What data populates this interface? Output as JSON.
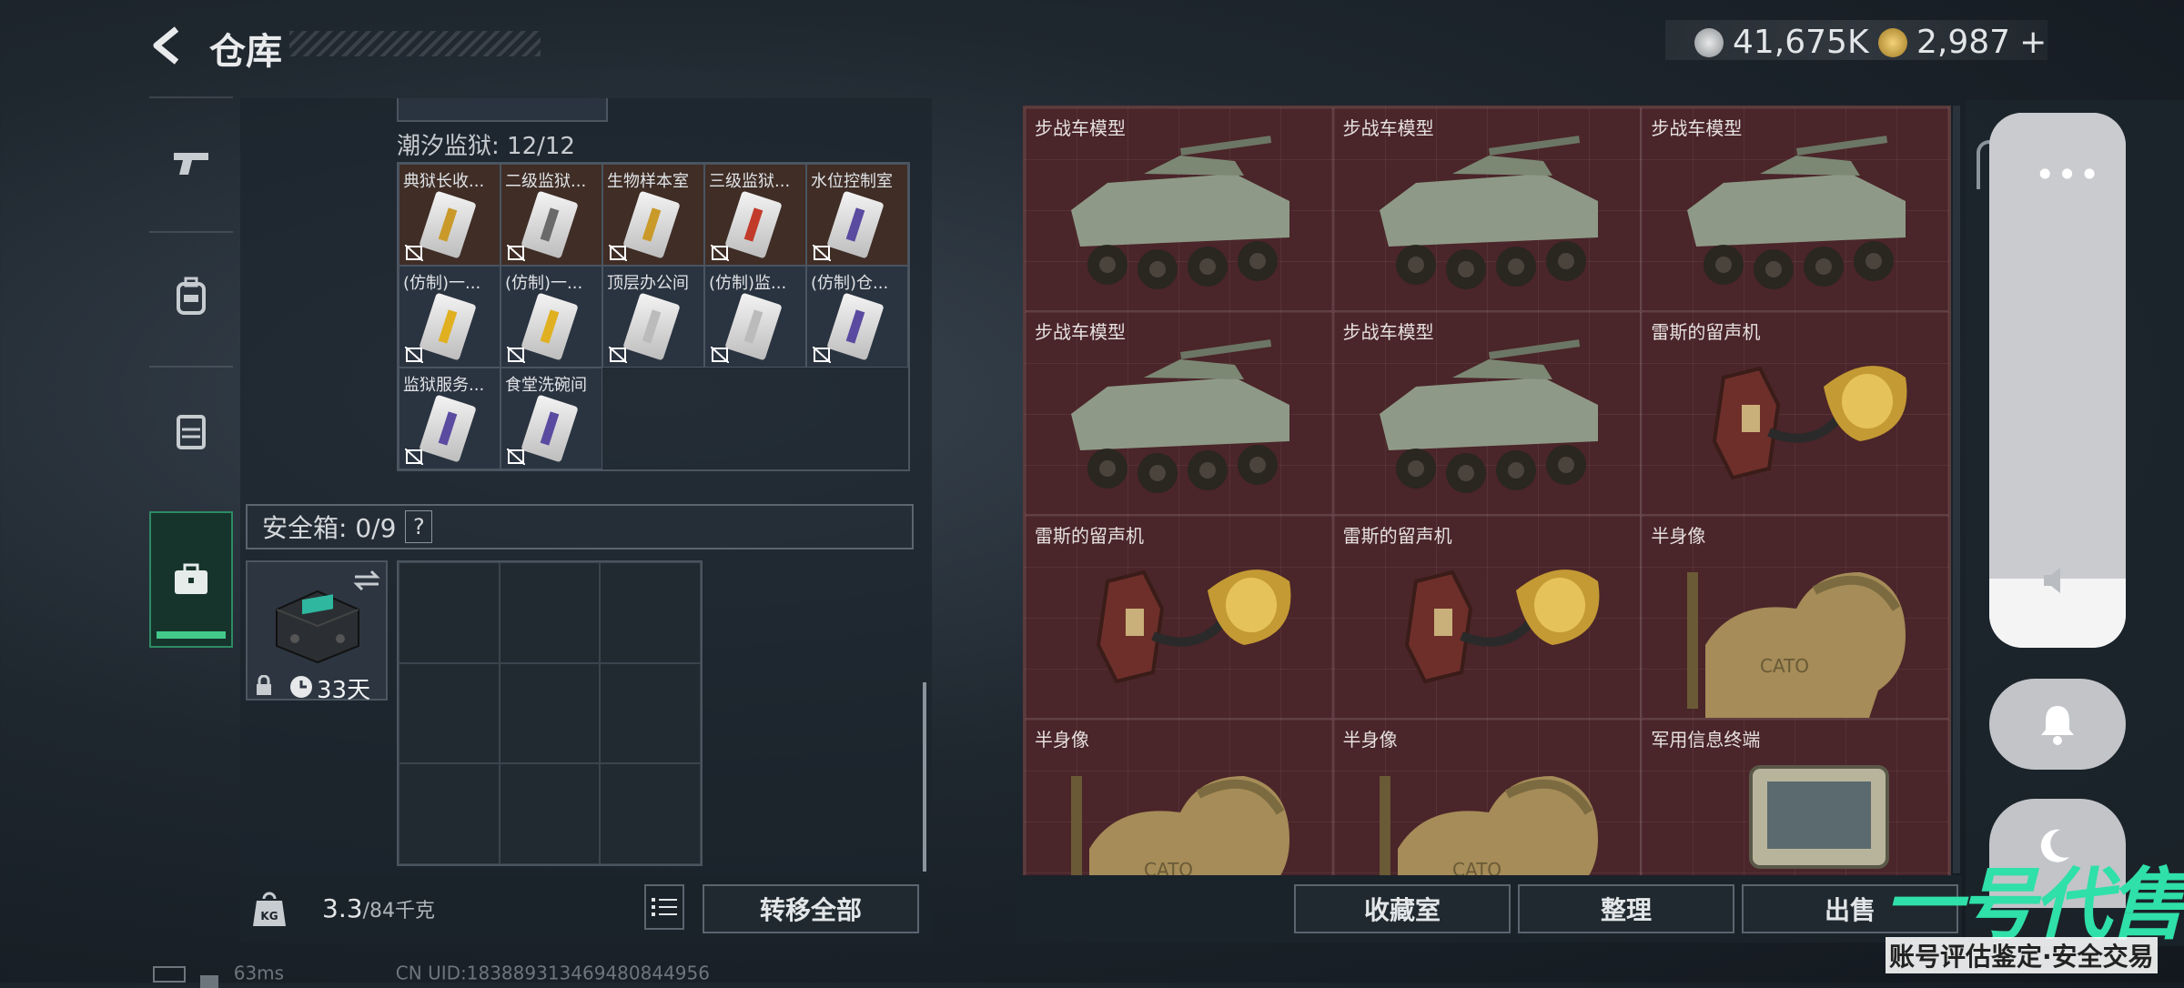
{
  "header": {
    "title": "仓库",
    "currency_1": "41,675K",
    "currency_2": "2,987",
    "currency_2_suffix": "+"
  },
  "left_tabs": [
    {
      "icon": "gun-icon"
    },
    {
      "icon": "backpack-icon"
    },
    {
      "icon": "vest-icon"
    },
    {
      "icon": "briefcase-icon",
      "active": true
    }
  ],
  "key_section": {
    "label": "潮汐监狱: 12/12",
    "items": [
      {
        "name": "典狱长收...",
        "tone": "gold",
        "stripe": "#c99a2a"
      },
      {
        "name": "二级监狱...",
        "tone": "gold",
        "stripe": "#6a6a6a"
      },
      {
        "name": "生物样本室",
        "tone": "gold",
        "stripe": "#c99a2a"
      },
      {
        "name": "三级监狱...",
        "tone": "gold",
        "stripe": "#c23a2a"
      },
      {
        "name": "水位控制室",
        "tone": "gold",
        "stripe": "#5a4aa0"
      },
      {
        "name": "(仿制)一...",
        "tone": "blue",
        "stripe": "#e0b020"
      },
      {
        "name": "(仿制)一...",
        "tone": "blue",
        "stripe": "#e0b020"
      },
      {
        "name": "顶层办公间",
        "tone": "blue",
        "stripe": "#bbbbbb"
      },
      {
        "name": "(仿制)监...",
        "tone": "blue",
        "stripe": "#bbbbbb"
      },
      {
        "name": "(仿制)仓...",
        "tone": "blue",
        "stripe": "#5a4aa0"
      },
      {
        "name": "监狱服务...",
        "tone": "blue",
        "stripe": "#5a4aa0"
      },
      {
        "name": "食堂洗碗间",
        "tone": "blue",
        "stripe": "#5a4aa0"
      }
    ]
  },
  "safe_box": {
    "label": "安全箱: 0/9",
    "help": "?",
    "timer": "33天"
  },
  "left_footer": {
    "weight": "3.3",
    "max": "/84千克",
    "transfer_all": "转移全部"
  },
  "collection": {
    "items": [
      {
        "name": "步战车模型",
        "kind": "ifv"
      },
      {
        "name": "步战车模型",
        "kind": "ifv"
      },
      {
        "name": "步战车模型",
        "kind": "ifv"
      },
      {
        "name": "步战车模型",
        "kind": "ifv"
      },
      {
        "name": "步战车模型",
        "kind": "ifv"
      },
      {
        "name": "雷斯的留声机",
        "kind": "phono"
      },
      {
        "name": "雷斯的留声机",
        "kind": "phono"
      },
      {
        "name": "雷斯的留声机",
        "kind": "phono"
      },
      {
        "name": "半身像",
        "kind": "bust"
      },
      {
        "name": "半身像",
        "kind": "bust"
      },
      {
        "name": "半身像",
        "kind": "bust"
      },
      {
        "name": "军用信息终端",
        "kind": "terminal"
      }
    ]
  },
  "right_footer": {
    "btn1": "收藏室",
    "btn2": "整理",
    "btn3": "出售"
  },
  "status_bar": {
    "ping": "63ms",
    "uid": "CN UID:1838893134694808449​56"
  },
  "watermark": {
    "big": "一号代售",
    "small": "账号评估鉴定·安全交易"
  }
}
